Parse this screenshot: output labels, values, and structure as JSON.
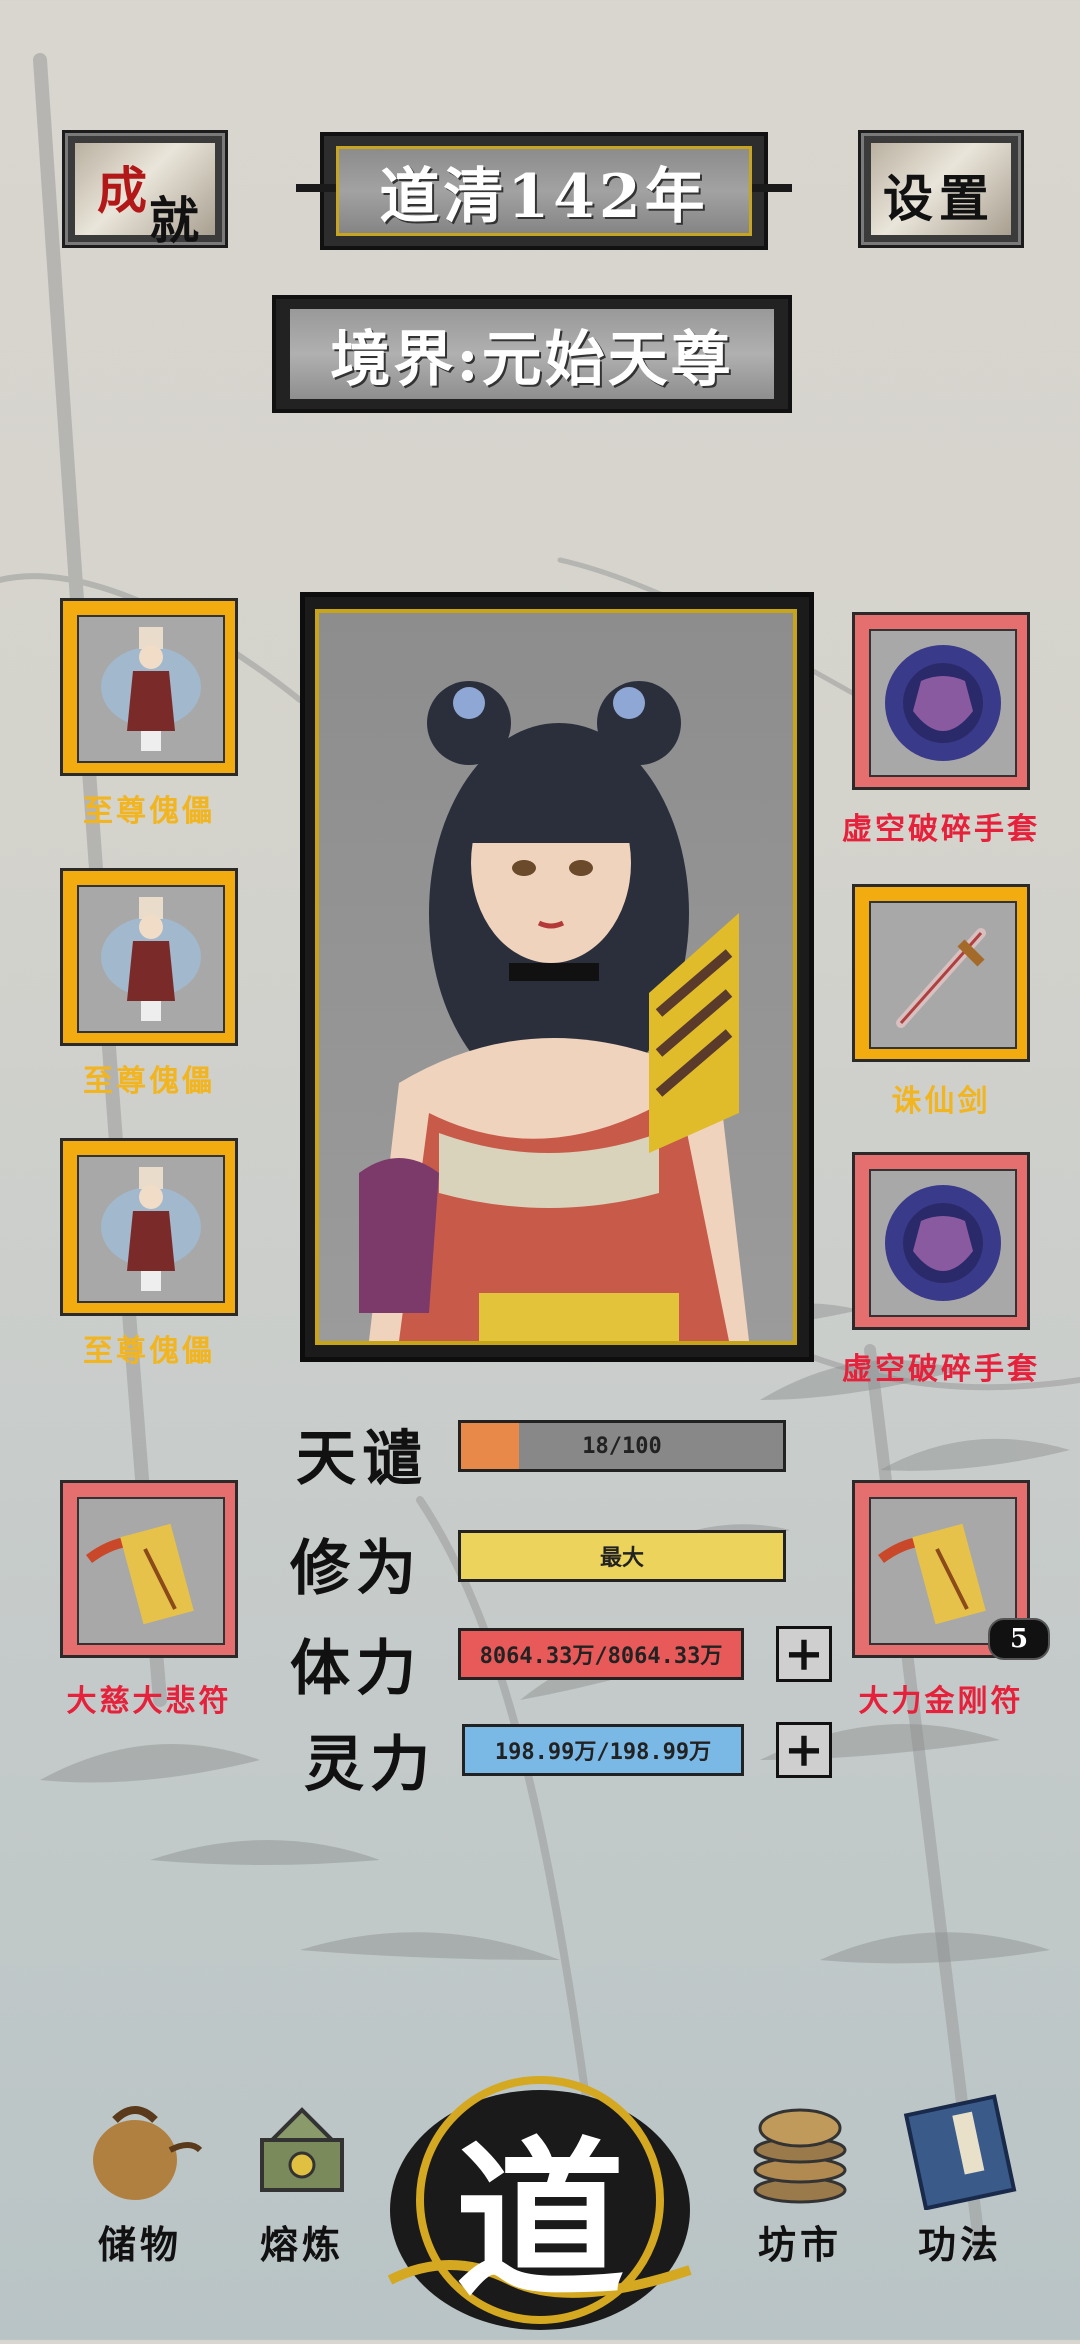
{
  "header": {
    "achievement_label_1": "成",
    "achievement_label_2": "就",
    "year_title": "道清142年",
    "settings_label": "设置",
    "realm_label": "境界:元始天尊"
  },
  "left_slots": [
    {
      "name": "至尊傀儡",
      "icon": "puppet-figure"
    },
    {
      "name": "至尊傀儡",
      "icon": "puppet-figure"
    },
    {
      "name": "至尊傀儡",
      "icon": "puppet-figure"
    },
    {
      "name": "大慈大悲符",
      "icon": "talisman-scroll"
    }
  ],
  "right_slots": [
    {
      "name": "虚空破碎手套",
      "icon": "void-glove"
    },
    {
      "name": "诛仙剑",
      "icon": "sword"
    },
    {
      "name": "虚空破碎手套",
      "icon": "void-glove"
    },
    {
      "name": "大力金刚符",
      "icon": "talisman-scroll",
      "count": "5"
    }
  ],
  "stats": {
    "tianqian_label": "天谴",
    "tianqian_value": "18/100",
    "tianqian_fraction": 0.18,
    "xiuwei_label": "修为",
    "xiuwei_value": "最大",
    "tili_label": "体力",
    "tili_value": "8064.33万/8064.33万",
    "lingli_label": "灵力",
    "lingli_value": "198.99万/198.99万",
    "plus": "+"
  },
  "nav": {
    "storage": "储物",
    "refine": "熔炼",
    "dao": "道",
    "market": "坊市",
    "skills": "功法"
  },
  "colors": {
    "gold_slot": "#f3ac10",
    "red_slot": "#e56e6e",
    "tianqian_fill": "#e8894a",
    "xiuwei_fill": "#ecd35c",
    "tili_fill": "#e85a5a",
    "lingli_fill": "#7ab8e6"
  }
}
